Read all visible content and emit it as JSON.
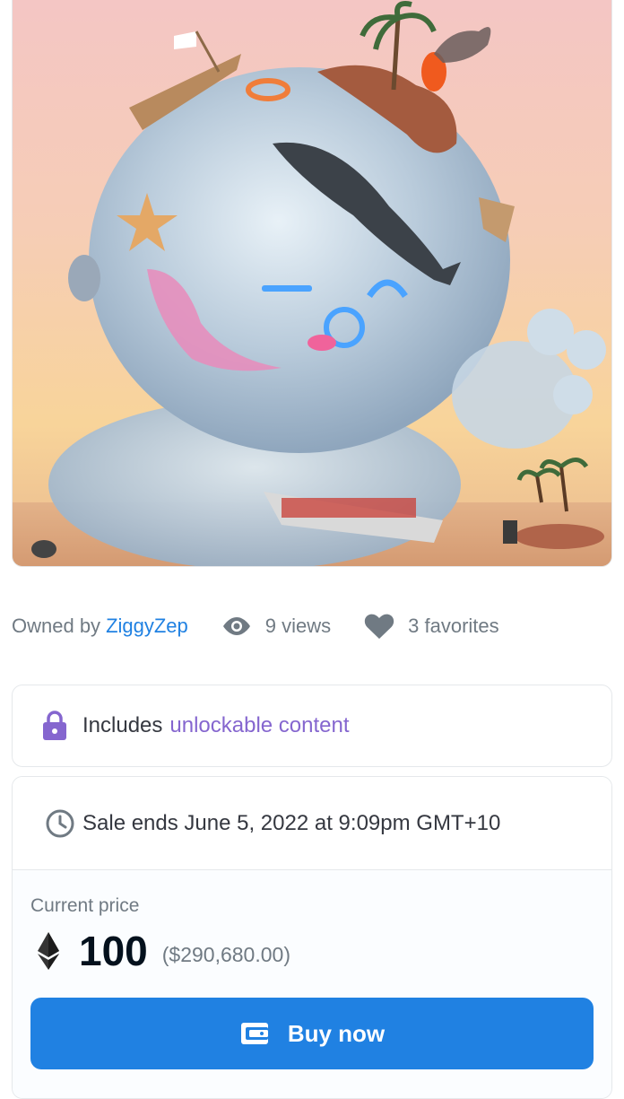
{
  "artwork": {
    "icon": "nft-artwork-image"
  },
  "meta": {
    "owner_label": "Owned by",
    "owner_name": "ZiggyZep",
    "views": "9 views",
    "favorites": "3 favorites",
    "views_icon": "eye-icon",
    "favorites_icon": "heart-icon"
  },
  "unlockable": {
    "prefix": "Includes",
    "link_text": "unlockable content",
    "icon": "lock-icon"
  },
  "sale": {
    "ends_text": "Sale ends June 5, 2022 at 9:09pm GMT+10",
    "clock_icon": "clock-icon",
    "price_label": "Current price",
    "price": "100",
    "price_usd": "($290,680.00)",
    "currency_icon": "ethereum-icon",
    "buy_label": "Buy now",
    "buy_icon": "wallet-icon"
  },
  "colors": {
    "link_blue": "#2081e2",
    "unlockable_purple": "#8566cf",
    "text_dark": "#353840",
    "text_muted": "#707a83"
  }
}
